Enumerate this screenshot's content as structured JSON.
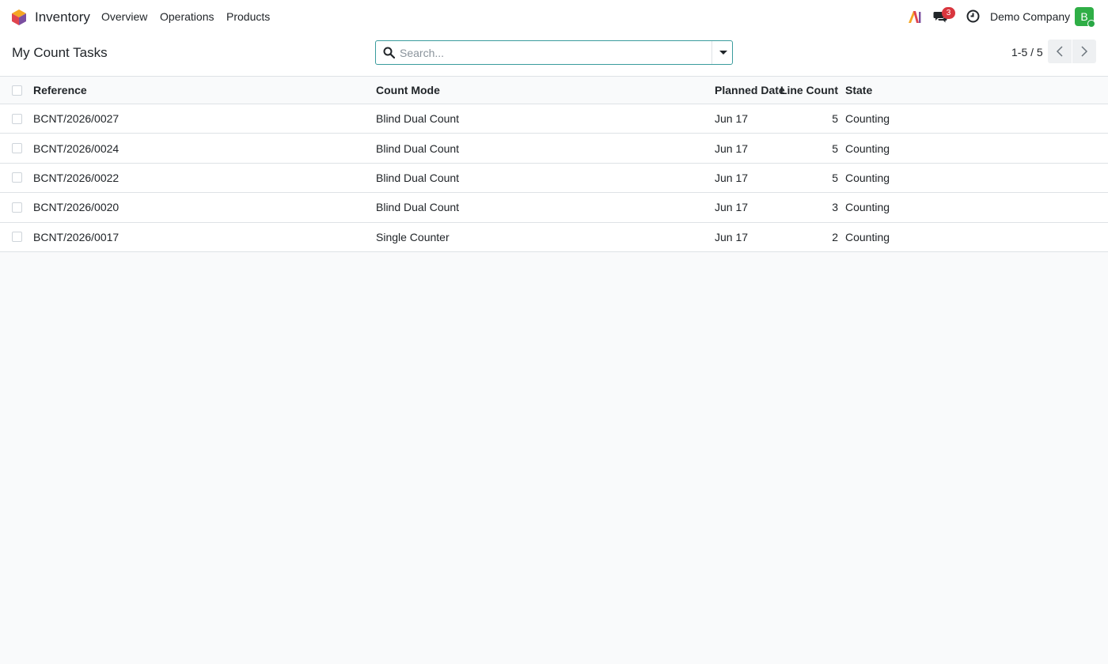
{
  "navbar": {
    "app_name": "Inventory",
    "menu": [
      "Overview",
      "Operations",
      "Products"
    ],
    "ai_label": "AI",
    "messages_count": "3",
    "company": "Demo Company",
    "avatar_initial": "B"
  },
  "control_panel": {
    "title": "My Count Tasks",
    "search_placeholder": "Search...",
    "pager": "1-5 / 5"
  },
  "table": {
    "columns": [
      "Reference",
      "Count Mode",
      "Planned Date",
      "Line Count",
      "State"
    ],
    "rows": [
      {
        "reference": "BCNT/2026/0027",
        "count_mode": "Blind Dual Count",
        "planned_date": "Jun 17",
        "line_count": "5",
        "state": "Counting"
      },
      {
        "reference": "BCNT/2026/0024",
        "count_mode": "Blind Dual Count",
        "planned_date": "Jun 17",
        "line_count": "5",
        "state": "Counting"
      },
      {
        "reference": "BCNT/2026/0022",
        "count_mode": "Blind Dual Count",
        "planned_date": "Jun 17",
        "line_count": "5",
        "state": "Counting"
      },
      {
        "reference": "BCNT/2026/0020",
        "count_mode": "Blind Dual Count",
        "planned_date": "Jun 17",
        "line_count": "3",
        "state": "Counting"
      },
      {
        "reference": "BCNT/2026/0017",
        "count_mode": "Single Counter",
        "planned_date": "Jun 17",
        "line_count": "2",
        "state": "Counting"
      }
    ]
  },
  "colors": {
    "accent": "#3a9c9d",
    "badge": "#d9363e",
    "avatar": "#2fae46"
  },
  "icons": {
    "app": "inventory-logo-icon",
    "ai": "ai-icon",
    "messages": "chat-icon",
    "activity": "clock-icon",
    "search": "search-icon",
    "filter": "caret-down-icon",
    "prev": "chevron-left-icon",
    "next": "chevron-right-icon"
  }
}
